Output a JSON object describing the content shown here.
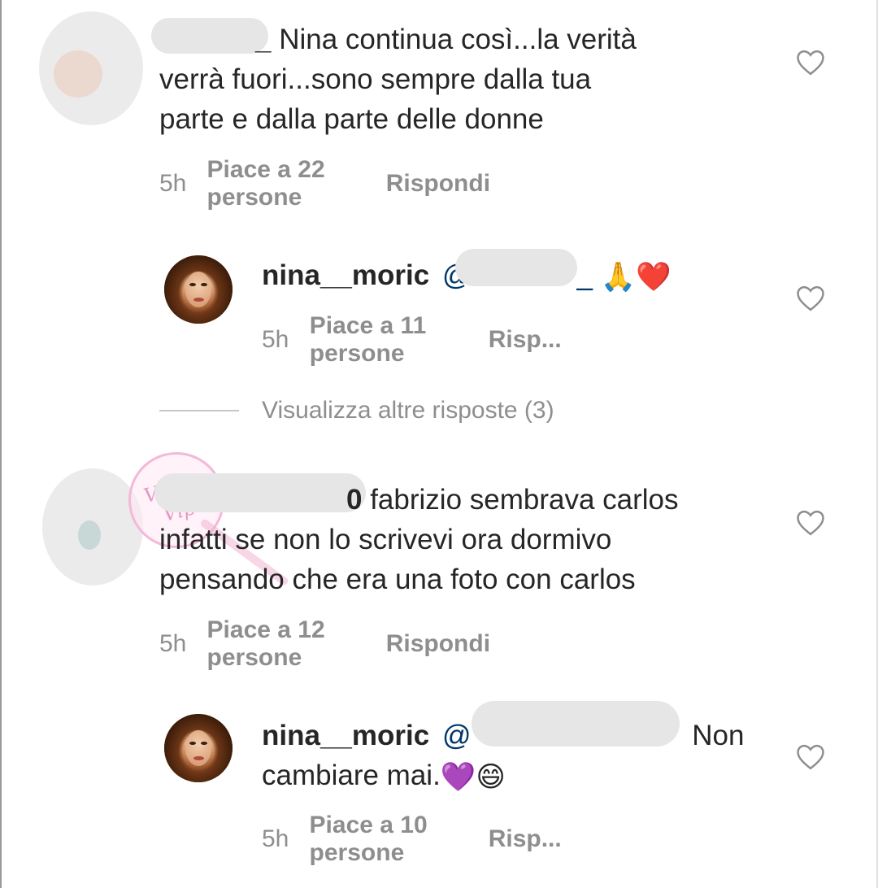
{
  "comments": [
    {
      "username_partial": "_",
      "text": "Nina continua così...la verità verrà fuori...sono sempre dalla tua parte e dalla parte delle donne",
      "line1": "Nina continua così...la verità",
      "line2": "verrà fuori...sono sempre dalla tua",
      "line3": "parte e dalla parte delle donne",
      "time": "5h",
      "likes": "Piace a 22 persone",
      "reply": "Rispondi"
    },
    {
      "username": "nina__moric",
      "mention": "@",
      "mention_tail": "_",
      "emojis": "🙏❤️",
      "time": "5h",
      "likes": "Piace a 11 persone",
      "reply": "Risp..."
    },
    {
      "username_partial": "0",
      "line1": "fabrizio sembrava carlos",
      "line2": "infatti se non lo scrivevi ora dormivo",
      "line3": "pensando che era una foto con carlos",
      "time": "5h",
      "likes": "Piace a 12 persone",
      "reply": "Rispondi"
    },
    {
      "username": "nina__moric",
      "mention": "@",
      "line1_tail": "Non",
      "line2": "cambiare mai.",
      "emojis": "💜😄",
      "time": "5h",
      "likes": "Piace a 10 persone",
      "reply": "Risp..."
    }
  ],
  "view_more": "Visualizza altre risposte (3)",
  "watermark": "Vicolo Vip",
  "icons": {
    "like": "heart-outline-icon"
  },
  "colors": {
    "text": "#262626",
    "meta": "#8e8e8e",
    "mention": "#00376b"
  }
}
